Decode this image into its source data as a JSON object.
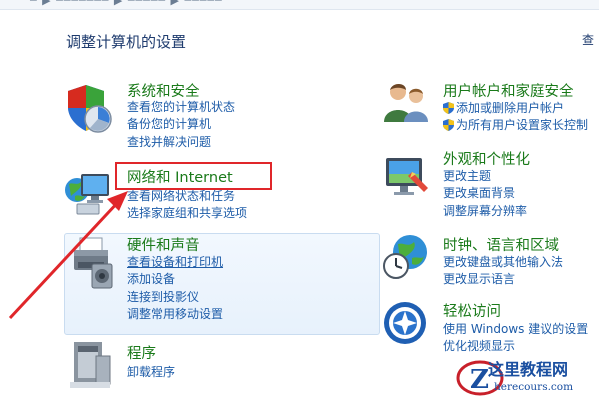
{
  "header": {
    "title": "调整计算机的设置",
    "view_by": "查"
  },
  "left": [
    {
      "id": "security",
      "title": "系统和安全",
      "links": [
        "查看您的计算机状态",
        "备份您的计算机",
        "查找并解决问题"
      ]
    },
    {
      "id": "network",
      "title": "网络和 Internet",
      "links": [
        "查看网络状态和任务",
        "选择家庭组和共享选项"
      ]
    },
    {
      "id": "hardware",
      "title": "硬件和声音",
      "links": [
        "查看设备和打印机",
        "添加设备",
        "连接到投影仪",
        "调整常用移动设置"
      ]
    },
    {
      "id": "programs",
      "title": "程序",
      "links": [
        "卸载程序"
      ]
    }
  ],
  "right": [
    {
      "id": "accounts",
      "title": "用户帐户和家庭安全",
      "links": [
        "添加或删除用户帐户",
        "为所有用户设置家长控制"
      ]
    },
    {
      "id": "appearance",
      "title": "外观和个性化",
      "links": [
        "更改主题",
        "更改桌面背景",
        "调整屏幕分辨率"
      ]
    },
    {
      "id": "clock",
      "title": "时钟、语言和区域",
      "links": [
        "更改键盘或其他输入法",
        "更改显示语言"
      ]
    },
    {
      "id": "ease",
      "title": "轻松访问",
      "links": [
        "使用 Windows 建议的设置",
        "优化视频显示"
      ]
    }
  ],
  "watermark": {
    "name": "这里教程网",
    "url": "herecours.com"
  }
}
